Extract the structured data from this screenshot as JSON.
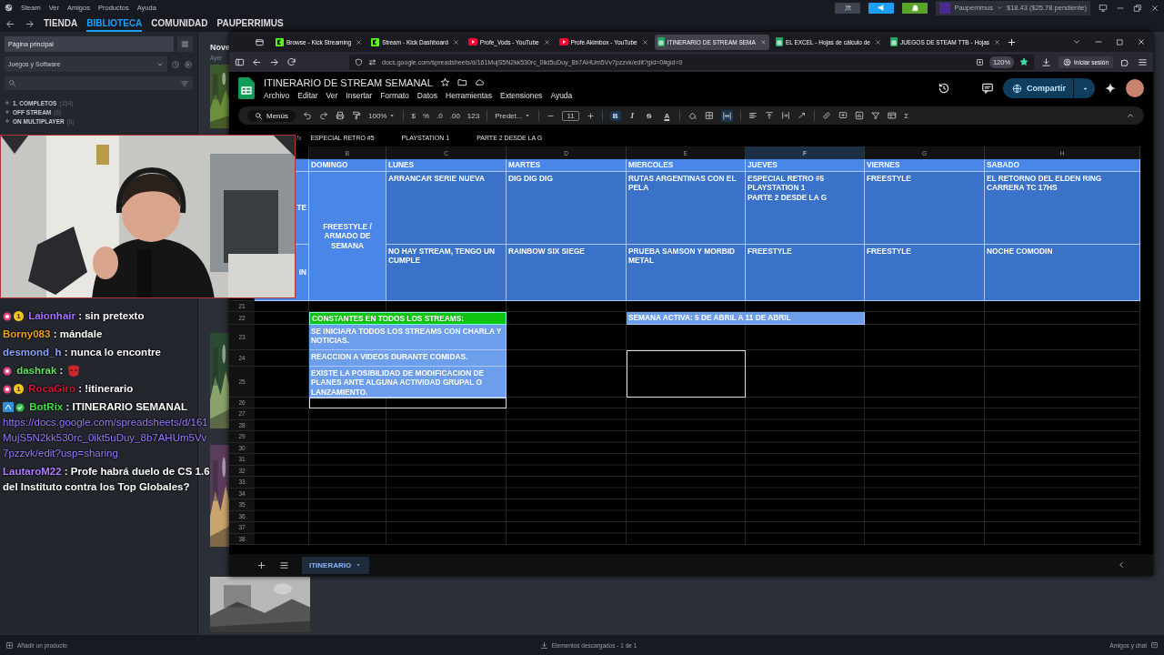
{
  "steam": {
    "menu": [
      "Steam",
      "Ver",
      "Amigos",
      "Productos",
      "Ayuda"
    ],
    "nav_tabs": [
      {
        "label": "TIENDA",
        "selected": false
      },
      {
        "label": "BIBLIOTECA",
        "selected": true
      },
      {
        "label": "COMUNIDAD",
        "selected": false
      },
      {
        "label": "PAUPERRIMUS",
        "selected": false
      }
    ],
    "account": {
      "name": "Pauperrimus",
      "balance": "$18.43 ($25.78 pendiente)"
    },
    "sidebar": {
      "home": "Página principal",
      "filter": "Juegos y Software",
      "collections": [
        {
          "label": "1. COMPLETOS",
          "count": "(154)"
        },
        {
          "label": "OFF STREAM",
          "count": "(6)"
        },
        {
          "label": "ON MULTIPLAYER",
          "count": "(6)"
        }
      ]
    },
    "shelf": {
      "title": "Nove",
      "subtitle": "Ayer"
    },
    "status_bar": {
      "add": "Añadir un producto",
      "downloads": "Elementos descargados - 1 de 1",
      "friends": "Amigos y chat"
    }
  },
  "browser": {
    "tabs": [
      {
        "title": "Browse - Kick Streaming",
        "kind": "kick",
        "selected": false
      },
      {
        "title": "Stream - Kick Dashboard",
        "kind": "kick",
        "selected": false
      },
      {
        "title": "Profe_Vods - YouTube",
        "kind": "youtube",
        "selected": false
      },
      {
        "title": "Profe Akimbox - YouTube",
        "kind": "youtube",
        "selected": false
      },
      {
        "title": "ITINERARIO DE STREAM SEMA",
        "kind": "sheets",
        "selected": true
      },
      {
        "title": "EL EXCEL - Hojas de cálculo de",
        "kind": "sheets",
        "selected": false
      },
      {
        "title": "JUEGOS DE STEAM TTB - Hojas",
        "kind": "sheets",
        "selected": false
      }
    ],
    "url": "docs.google.com/spreadsheets/d/161MujS5N2kk530rc_0ikt5uDuy_8b7AHUm5Vv7pzzvk/edit?gid=0#gid=0",
    "zoom": "120%",
    "sign_in": "Iniciar sesión"
  },
  "sheets": {
    "title": "ITINERARIO DE STREAM SEMANAL",
    "menu": [
      "Archivo",
      "Editar",
      "Ver",
      "Insertar",
      "Formato",
      "Datos",
      "Herramientas",
      "Extensiones",
      "Ayuda"
    ],
    "share": "Compartir",
    "toolbar": {
      "search": "Menús",
      "zoom": "100%",
      "currency": "$",
      "percent": "%",
      "decimal_less": ".0",
      "decimal_more": ".00",
      "number_format": "123",
      "font": "Predet...",
      "font_size": "11",
      "bold": "B",
      "bold_active": true,
      "italic": "I",
      "strike": "S",
      "text_color": "A",
      "merge_active": true,
      "sum": "Σ"
    },
    "formula_icon": "fx",
    "formula": [
      "ESPECIAL RETRO #5",
      "PLAYSTATION 1",
      "PARTE 2 DESDE LA G"
    ],
    "columns": [
      {
        "label": "B",
        "selected": false
      },
      {
        "label": "C",
        "selected": false
      },
      {
        "label": "D",
        "selected": false
      },
      {
        "label": "E",
        "selected": false
      },
      {
        "label": "F",
        "selected": true
      },
      {
        "label": "G",
        "selected": false
      },
      {
        "label": "H",
        "selected": false
      }
    ],
    "days": [
      "DOMINGO",
      "LUNES",
      "MARTES",
      "MIERCOLES",
      "JUEVES",
      "VIERNES",
      "SABADO"
    ],
    "row_labels": [
      "TE",
      "IN"
    ],
    "merged_label": "FREESTYLE / ARMADO DE SEMANA",
    "slots": [
      [
        "ARRANCAR SERIE NUEVA",
        "DIG DIG DIG",
        "RUTAS ARGENTINAS CON EL PELA",
        "ESPECIAL RETRO #5\nPLAYSTATION 1\nPARTE 2 DESDE LA G",
        "FREESTYLE",
        "EL RETORNO DEL ELDEN RING\nCARRERA TC 17HS"
      ],
      [
        "NO HAY STREAM, TENGO UN CUMPLE",
        "RAINBOW SIX SIEGE",
        "PRUEBA SAMSON Y MORBID METAL",
        "FREESTYLE",
        "FREESTYLE",
        "NOCHE COMODIN"
      ]
    ],
    "row_numbers": [
      "21",
      "22",
      "23",
      "24",
      "25",
      "26",
      "27",
      "28",
      "29",
      "30",
      "31",
      "32",
      "33",
      "34",
      "35",
      "36",
      "37",
      "38"
    ],
    "notes_title": "CONSTANTES EN TODOS LOS STREAMS:",
    "notes": [
      "SE INICIARA TODOS LOS STREAMS CON CHARLA Y NOTICIAS.",
      "REACCION A VIDEOS DURANTE COMIDAS.",
      "EXISTE LA POSIBILIDAD DE MODIFICACION DE PLANES ANTE ALGUNA ACTIVIDAD GRUPAL O LANZAMIENTO."
    ],
    "active_week": "SEMANA ACTIVA: 5 DE ABRIL A 11 DE ABRIL",
    "sheet_tabs": [
      {
        "label": "ITINERARIO",
        "selected": true
      }
    ]
  },
  "chat": [
    {
      "user": "Laionhair",
      "color": "#a970ff",
      "separator": ":",
      "kind": "text",
      "text": "sin pretexto",
      "badges": [
        {
          "kind": "gem"
        },
        {
          "kind": "tier",
          "label": "1"
        }
      ]
    },
    {
      "user": "Borny083",
      "color": "#e8a020",
      "separator": ":",
      "kind": "text",
      "text": "mándale"
    },
    {
      "user": "desmond_h",
      "color": "#8ea2ff",
      "separator": ":",
      "kind": "text",
      "text": "nunca lo encontre"
    },
    {
      "user": "dashrak",
      "color": "#5ee05e",
      "separator": ":",
      "kind": "emote",
      "badges": [
        {
          "kind": "gem"
        }
      ]
    },
    {
      "user": "RocaGiro",
      "color": "#d4143c",
      "separator": ":",
      "kind": "text",
      "text": "!itinerario",
      "badges": [
        {
          "kind": "gem"
        },
        {
          "kind": "tier",
          "label": "1"
        }
      ]
    },
    {
      "user": "BotRix",
      "color": "#3fe23f",
      "separator": ":",
      "kind": "text",
      "text": "ITINERARIO SEMANAL",
      "link": "https://docs.google.com/spreadsheets/d/161MujS5N2kk530rc_0ikt5uDuy_8b7AHUm5Vv7pzzvk/edit?usp=sharing",
      "badges": [
        {
          "kind": "bot"
        },
        {
          "kind": "verified"
        }
      ]
    },
    {
      "user": "LautaroM22",
      "color": "#b07cff",
      "separator": ":",
      "kind": "text",
      "text": "Profe habrá duelo de CS 1.6",
      "continuation": "del Instituto contra los Top Globales?"
    }
  ]
}
